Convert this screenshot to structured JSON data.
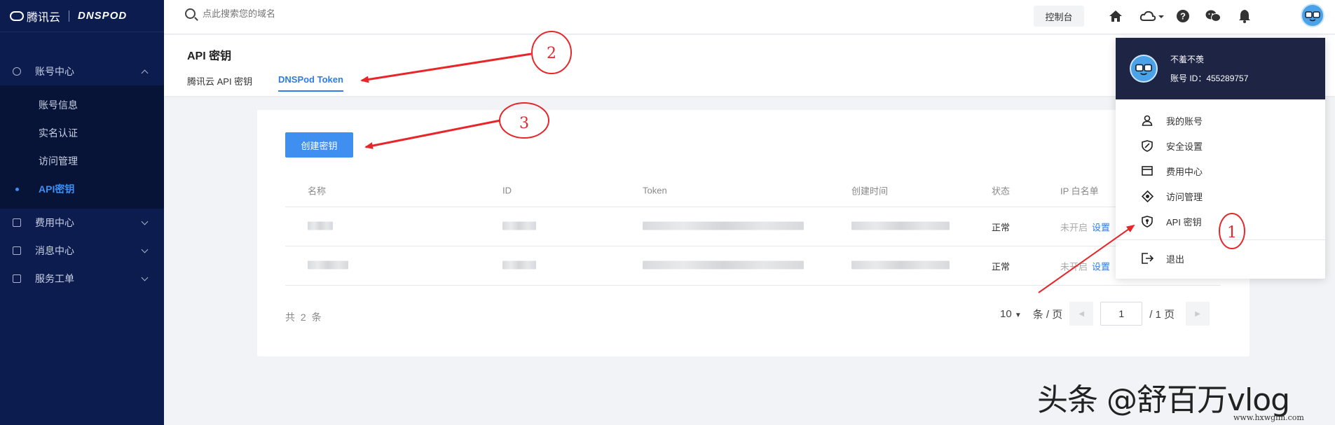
{
  "brand": {
    "name": "腾讯云",
    "product": "DNSPOD"
  },
  "sidebar": {
    "groups": [
      {
        "label": "账号中心",
        "expanded": true,
        "items": [
          {
            "label": "账号信息"
          },
          {
            "label": "实名认证"
          },
          {
            "label": "访问管理"
          },
          {
            "label": "API密钥",
            "active": true
          }
        ]
      },
      {
        "label": "费用中心",
        "expanded": false
      },
      {
        "label": "消息中心",
        "expanded": false
      },
      {
        "label": "服务工单",
        "expanded": false
      }
    ]
  },
  "header": {
    "search_placeholder": "点此搜索您的域名",
    "console_label": "控制台",
    "icons": [
      "home-icon",
      "cloud-icon",
      "help-icon",
      "wechat-icon",
      "bell-icon",
      "avatar"
    ]
  },
  "page": {
    "title": "API 密钥",
    "tabs": [
      {
        "label": "腾讯云 API 密钥",
        "active": false
      },
      {
        "label": "DNSPod Token",
        "active": true
      }
    ]
  },
  "token_table": {
    "create_button": "创建密钥",
    "columns": [
      "名称",
      "ID",
      "Token",
      "创建时间",
      "状态",
      "IP 白名单"
    ],
    "rows": [
      {
        "status": "正常",
        "ip_whitelist": "未开启",
        "action": "设置"
      },
      {
        "status": "正常",
        "ip_whitelist": "未开启",
        "action": "设置"
      }
    ],
    "total": "共 2 条",
    "page_size": "10",
    "page_size_unit": "条 / 页",
    "current_page": "1",
    "total_pages": "/ 1 页"
  },
  "user_menu": {
    "name": "不羞不羡",
    "account_id": "账号 ID：455289757",
    "items": [
      {
        "label": "我的账号",
        "icon": "user-icon"
      },
      {
        "label": "安全设置",
        "icon": "shield-icon"
      },
      {
        "label": "费用中心",
        "icon": "wallet-icon"
      },
      {
        "label": "访问管理",
        "icon": "access-icon"
      },
      {
        "label": "API 密钥",
        "icon": "key-shield-icon"
      }
    ],
    "logout": "退出"
  },
  "annotations": {
    "markers": [
      "1",
      "2",
      "3"
    ],
    "accent": "#e8262a"
  },
  "watermark": {
    "text": "头条 @舒百万vlog",
    "site": "www.hxwglm.com"
  }
}
